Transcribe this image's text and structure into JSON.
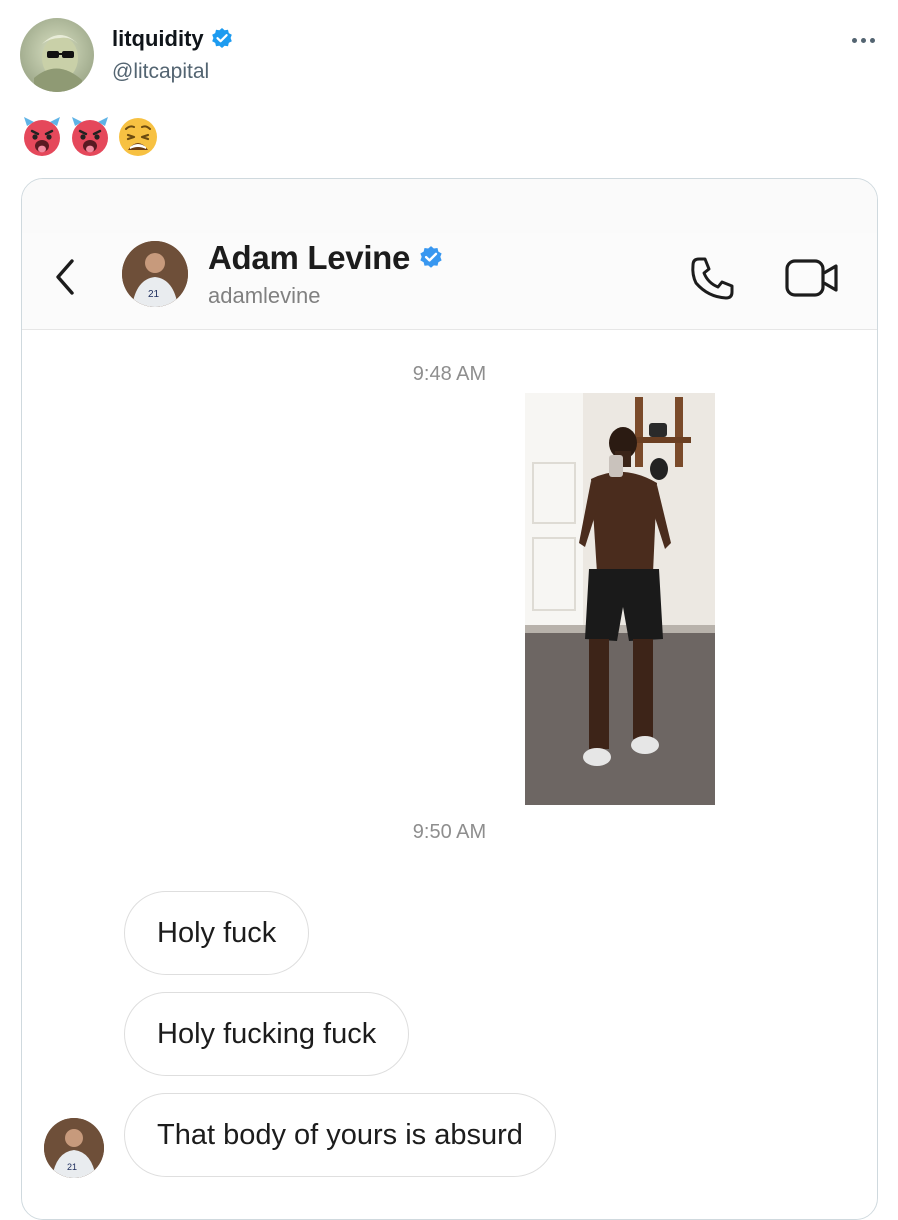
{
  "tweet": {
    "display_name": "litquidity",
    "handle": "@litcapital",
    "emojis": [
      "hot-face-devil-icon",
      "hot-face-devil-icon",
      "weary-face-icon"
    ]
  },
  "dm": {
    "contact_name": "Adam Levine",
    "contact_username": "adamlevine",
    "timestamps": [
      "9:48 AM",
      "9:50 AM"
    ],
    "messages": [
      "Holy fuck",
      "Holy fucking fuck",
      "That body of yours is absurd"
    ]
  },
  "colors": {
    "verified_twitter": "#1d9bf0",
    "verified_instagram": "#3897f0",
    "text_primary": "#0f1419",
    "text_secondary": "#536471"
  }
}
